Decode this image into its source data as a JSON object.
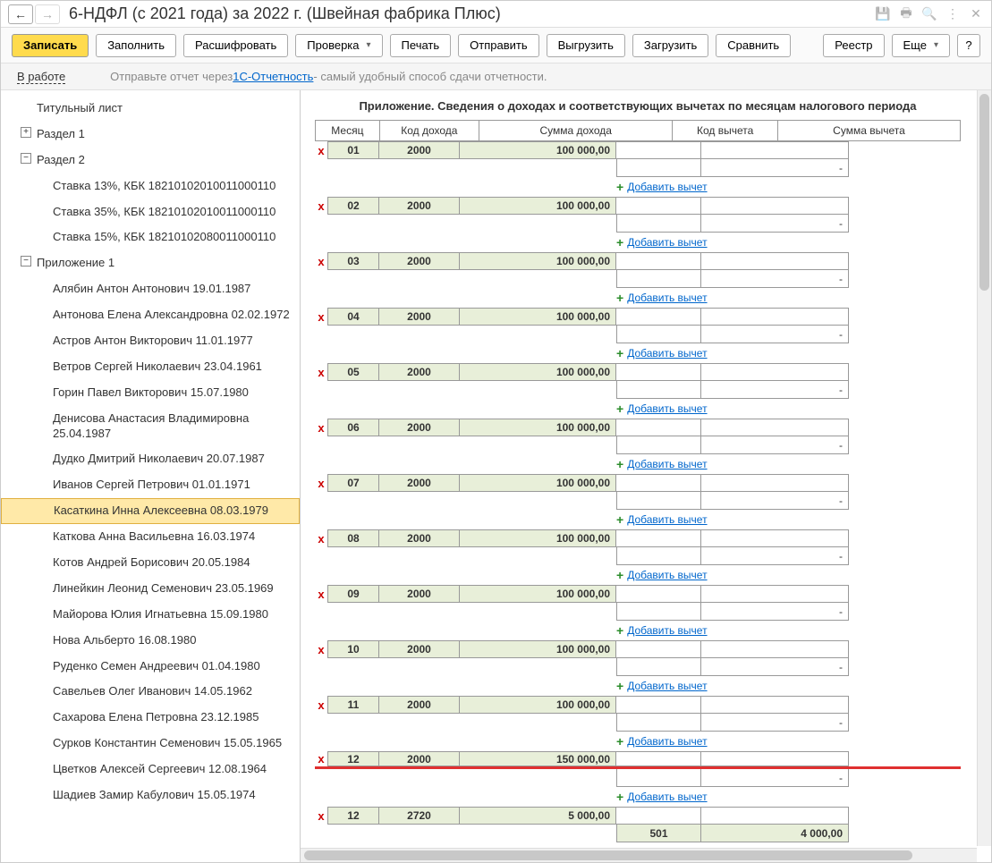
{
  "titlebar": {
    "title": "6-НДФЛ (с 2021 года) за 2022 г. (Швейная фабрика Плюс)"
  },
  "toolbar": {
    "write": "Записать",
    "fill": "Заполнить",
    "decode": "Расшифровать",
    "check": "Проверка",
    "print": "Печать",
    "send": "Отправить",
    "upload": "Выгрузить",
    "load": "Загрузить",
    "compare": "Сравнить",
    "registry": "Реестр",
    "more": "Еще",
    "help": "?"
  },
  "infobar": {
    "status": "В работе",
    "text1": "Отправьте отчет через ",
    "link": "1С-Отчетность",
    "text2": " - самый удобный способ сдачи отчетности."
  },
  "tree": {
    "items": [
      {
        "label": "Титульный лист",
        "level": 0
      },
      {
        "label": "Раздел 1",
        "level": 0,
        "toggle": "+"
      },
      {
        "label": "Раздел 2",
        "level": 0,
        "toggle": "−"
      },
      {
        "label": "Ставка 13%, КБК 18210102010011000110",
        "level": 2
      },
      {
        "label": "Ставка 35%, КБК 18210102010011000110",
        "level": 2
      },
      {
        "label": "Ставка 15%, КБК 18210102080011000110",
        "level": 2
      },
      {
        "label": "Приложение 1",
        "level": 1,
        "toggle": "−"
      },
      {
        "label": "Алябин Антон Антонович 19.01.1987",
        "level": 2
      },
      {
        "label": "Антонова Елена Александровна 02.02.1972",
        "level": 2
      },
      {
        "label": "Астров Антон Викторович 11.01.1977",
        "level": 2
      },
      {
        "label": "Ветров Сергей Николаевич 23.04.1961",
        "level": 2
      },
      {
        "label": "Горин Павел Викторович 15.07.1980",
        "level": 2
      },
      {
        "label": "Денисова Анастасия Владимировна 25.04.1987",
        "level": 2
      },
      {
        "label": "Дудко Дмитрий Николаевич 20.07.1987",
        "level": 2
      },
      {
        "label": "Иванов Сергей Петрович 01.01.1971",
        "level": 2
      },
      {
        "label": "Касаткина Инна Алексеевна 08.03.1979",
        "level": 2,
        "selected": true
      },
      {
        "label": "Каткова Анна Васильевна 16.03.1974",
        "level": 2
      },
      {
        "label": "Котов Андрей Борисович 20.05.1984",
        "level": 2
      },
      {
        "label": "Линейкин Леонид Семенович 23.05.1969",
        "level": 2
      },
      {
        "label": "Майорова Юлия Игнатьевна 15.09.1980",
        "level": 2
      },
      {
        "label": "Нова Альберто 16.08.1980",
        "level": 2
      },
      {
        "label": "Руденко Семен Андреевич 01.04.1980",
        "level": 2
      },
      {
        "label": "Савельев Олег Иванович 14.05.1962",
        "level": 2
      },
      {
        "label": "Сахарова Елена Петровна 23.12.1985",
        "level": 2
      },
      {
        "label": "Сурков Константин Семенович 15.05.1965",
        "level": 2
      },
      {
        "label": "Цветков Алексей Сергеевич 12.08.1964",
        "level": 2
      },
      {
        "label": "Шадиев Замир Кабулович 15.05.1974",
        "level": 2
      }
    ]
  },
  "panel": {
    "title": "Приложение. Сведения о доходах и соответствующих вычетах по месяцам налогового периода",
    "headers": {
      "month": "Месяц",
      "income_code": "Код дохода",
      "income_amount": "Сумма дохода",
      "deduction_code": "Код вычета",
      "deduction_amount": "Сумма вычета"
    },
    "add_label": "Добавить вычет",
    "rows": [
      {
        "month": "01",
        "code": "2000",
        "amount": "100 000,00",
        "dcode": "",
        "damount": "-"
      },
      {
        "month": "02",
        "code": "2000",
        "amount": "100 000,00",
        "dcode": "",
        "damount": "-"
      },
      {
        "month": "03",
        "code": "2000",
        "amount": "100 000,00",
        "dcode": "",
        "damount": "-"
      },
      {
        "month": "04",
        "code": "2000",
        "amount": "100 000,00",
        "dcode": "",
        "damount": "-"
      },
      {
        "month": "05",
        "code": "2000",
        "amount": "100 000,00",
        "dcode": "",
        "damount": "-"
      },
      {
        "month": "06",
        "code": "2000",
        "amount": "100 000,00",
        "dcode": "",
        "damount": "-"
      },
      {
        "month": "07",
        "code": "2000",
        "amount": "100 000,00",
        "dcode": "",
        "damount": "-"
      },
      {
        "month": "08",
        "code": "2000",
        "amount": "100 000,00",
        "dcode": "",
        "damount": "-"
      },
      {
        "month": "09",
        "code": "2000",
        "amount": "100 000,00",
        "dcode": "",
        "damount": "-"
      },
      {
        "month": "10",
        "code": "2000",
        "amount": "100 000,00",
        "dcode": "",
        "damount": "-"
      },
      {
        "month": "11",
        "code": "2000",
        "amount": "100 000,00",
        "dcode": "",
        "damount": "-"
      },
      {
        "month": "12",
        "code": "2000",
        "amount": "150 000,00",
        "dcode": "",
        "damount": "-",
        "highlight": true
      },
      {
        "month": "12",
        "code": "2720",
        "amount": "5 000,00",
        "dcode": "501",
        "damount": "4 000,00"
      }
    ]
  }
}
